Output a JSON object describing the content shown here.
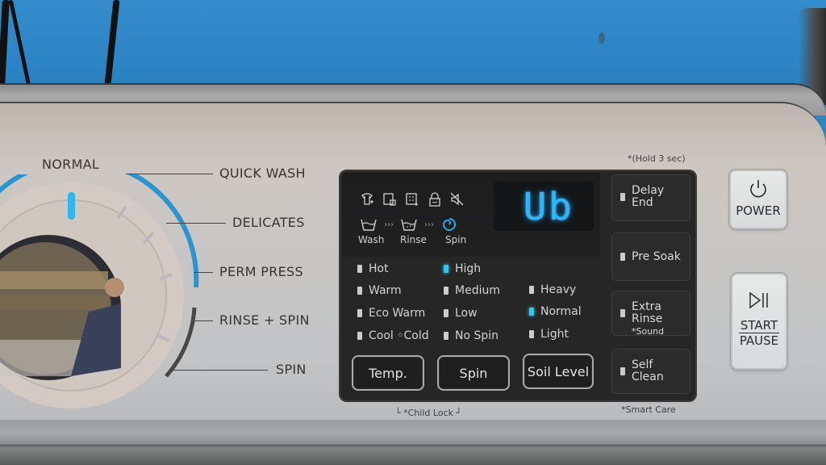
{
  "scene": "Washing machine control panel",
  "dial": {
    "cycles": [
      "NORMAL",
      "QUICK WASH",
      "DELICATES",
      "PERM PRESS",
      "RINSE + SPIN",
      "SPIN"
    ],
    "selected": "NORMAL"
  },
  "status": {
    "icons": [
      "shirt-plus-icon",
      "lock-door-icon",
      "smart-check-icon",
      "child-lock-icon",
      "mute-icon"
    ],
    "cycle_steps": [
      {
        "label": "Wash",
        "icon": "wash-tub-icon",
        "active": false
      },
      {
        "label": "Rinse",
        "icon": "rinse-tub-icon",
        "active": false
      },
      {
        "label": "Spin",
        "icon": "spin-swirl-icon",
        "active": true
      }
    ],
    "display_code": "Ub",
    "display_color": "#2bb6ff"
  },
  "temp": {
    "options": [
      {
        "label": "Hot",
        "on": false
      },
      {
        "label": "Warm",
        "on": false
      },
      {
        "label": "Eco Warm",
        "on": false
      },
      {
        "label": "Cool ◦Cold",
        "on": false
      }
    ],
    "button": "Temp."
  },
  "spin": {
    "options": [
      {
        "label": "High",
        "on": true
      },
      {
        "label": "Medium",
        "on": false
      },
      {
        "label": "Low",
        "on": false
      },
      {
        "label": "No Spin",
        "on": false
      }
    ],
    "button": "Spin"
  },
  "soil": {
    "options": [
      {
        "label": "Heavy",
        "on": false
      },
      {
        "label": "Normal",
        "on": true
      },
      {
        "label": "Light",
        "on": false
      }
    ],
    "button": "Soil Level"
  },
  "side_buttons": {
    "hold_note": "*(Hold 3 sec)",
    "delay_end": [
      "Delay",
      "End"
    ],
    "pre_soak": "Pre Soak",
    "extra_rinse": "Extra Rinse",
    "extra_rinse_sub": "*Sound",
    "self_clean": [
      "Self",
      "Clean"
    ],
    "smart_care_note": "*Smart Care"
  },
  "child_lock_note": "└ *Child Lock ┘",
  "power": {
    "label": "POWER",
    "icon": "power-icon"
  },
  "start_pause": {
    "label_top": "START",
    "label_bottom": "PAUSE",
    "icon": "play-pause-icon"
  },
  "colors": {
    "accent_led": "#33c6ea",
    "dial_arc": "#2a95d0",
    "wall": "#2f86c3"
  }
}
